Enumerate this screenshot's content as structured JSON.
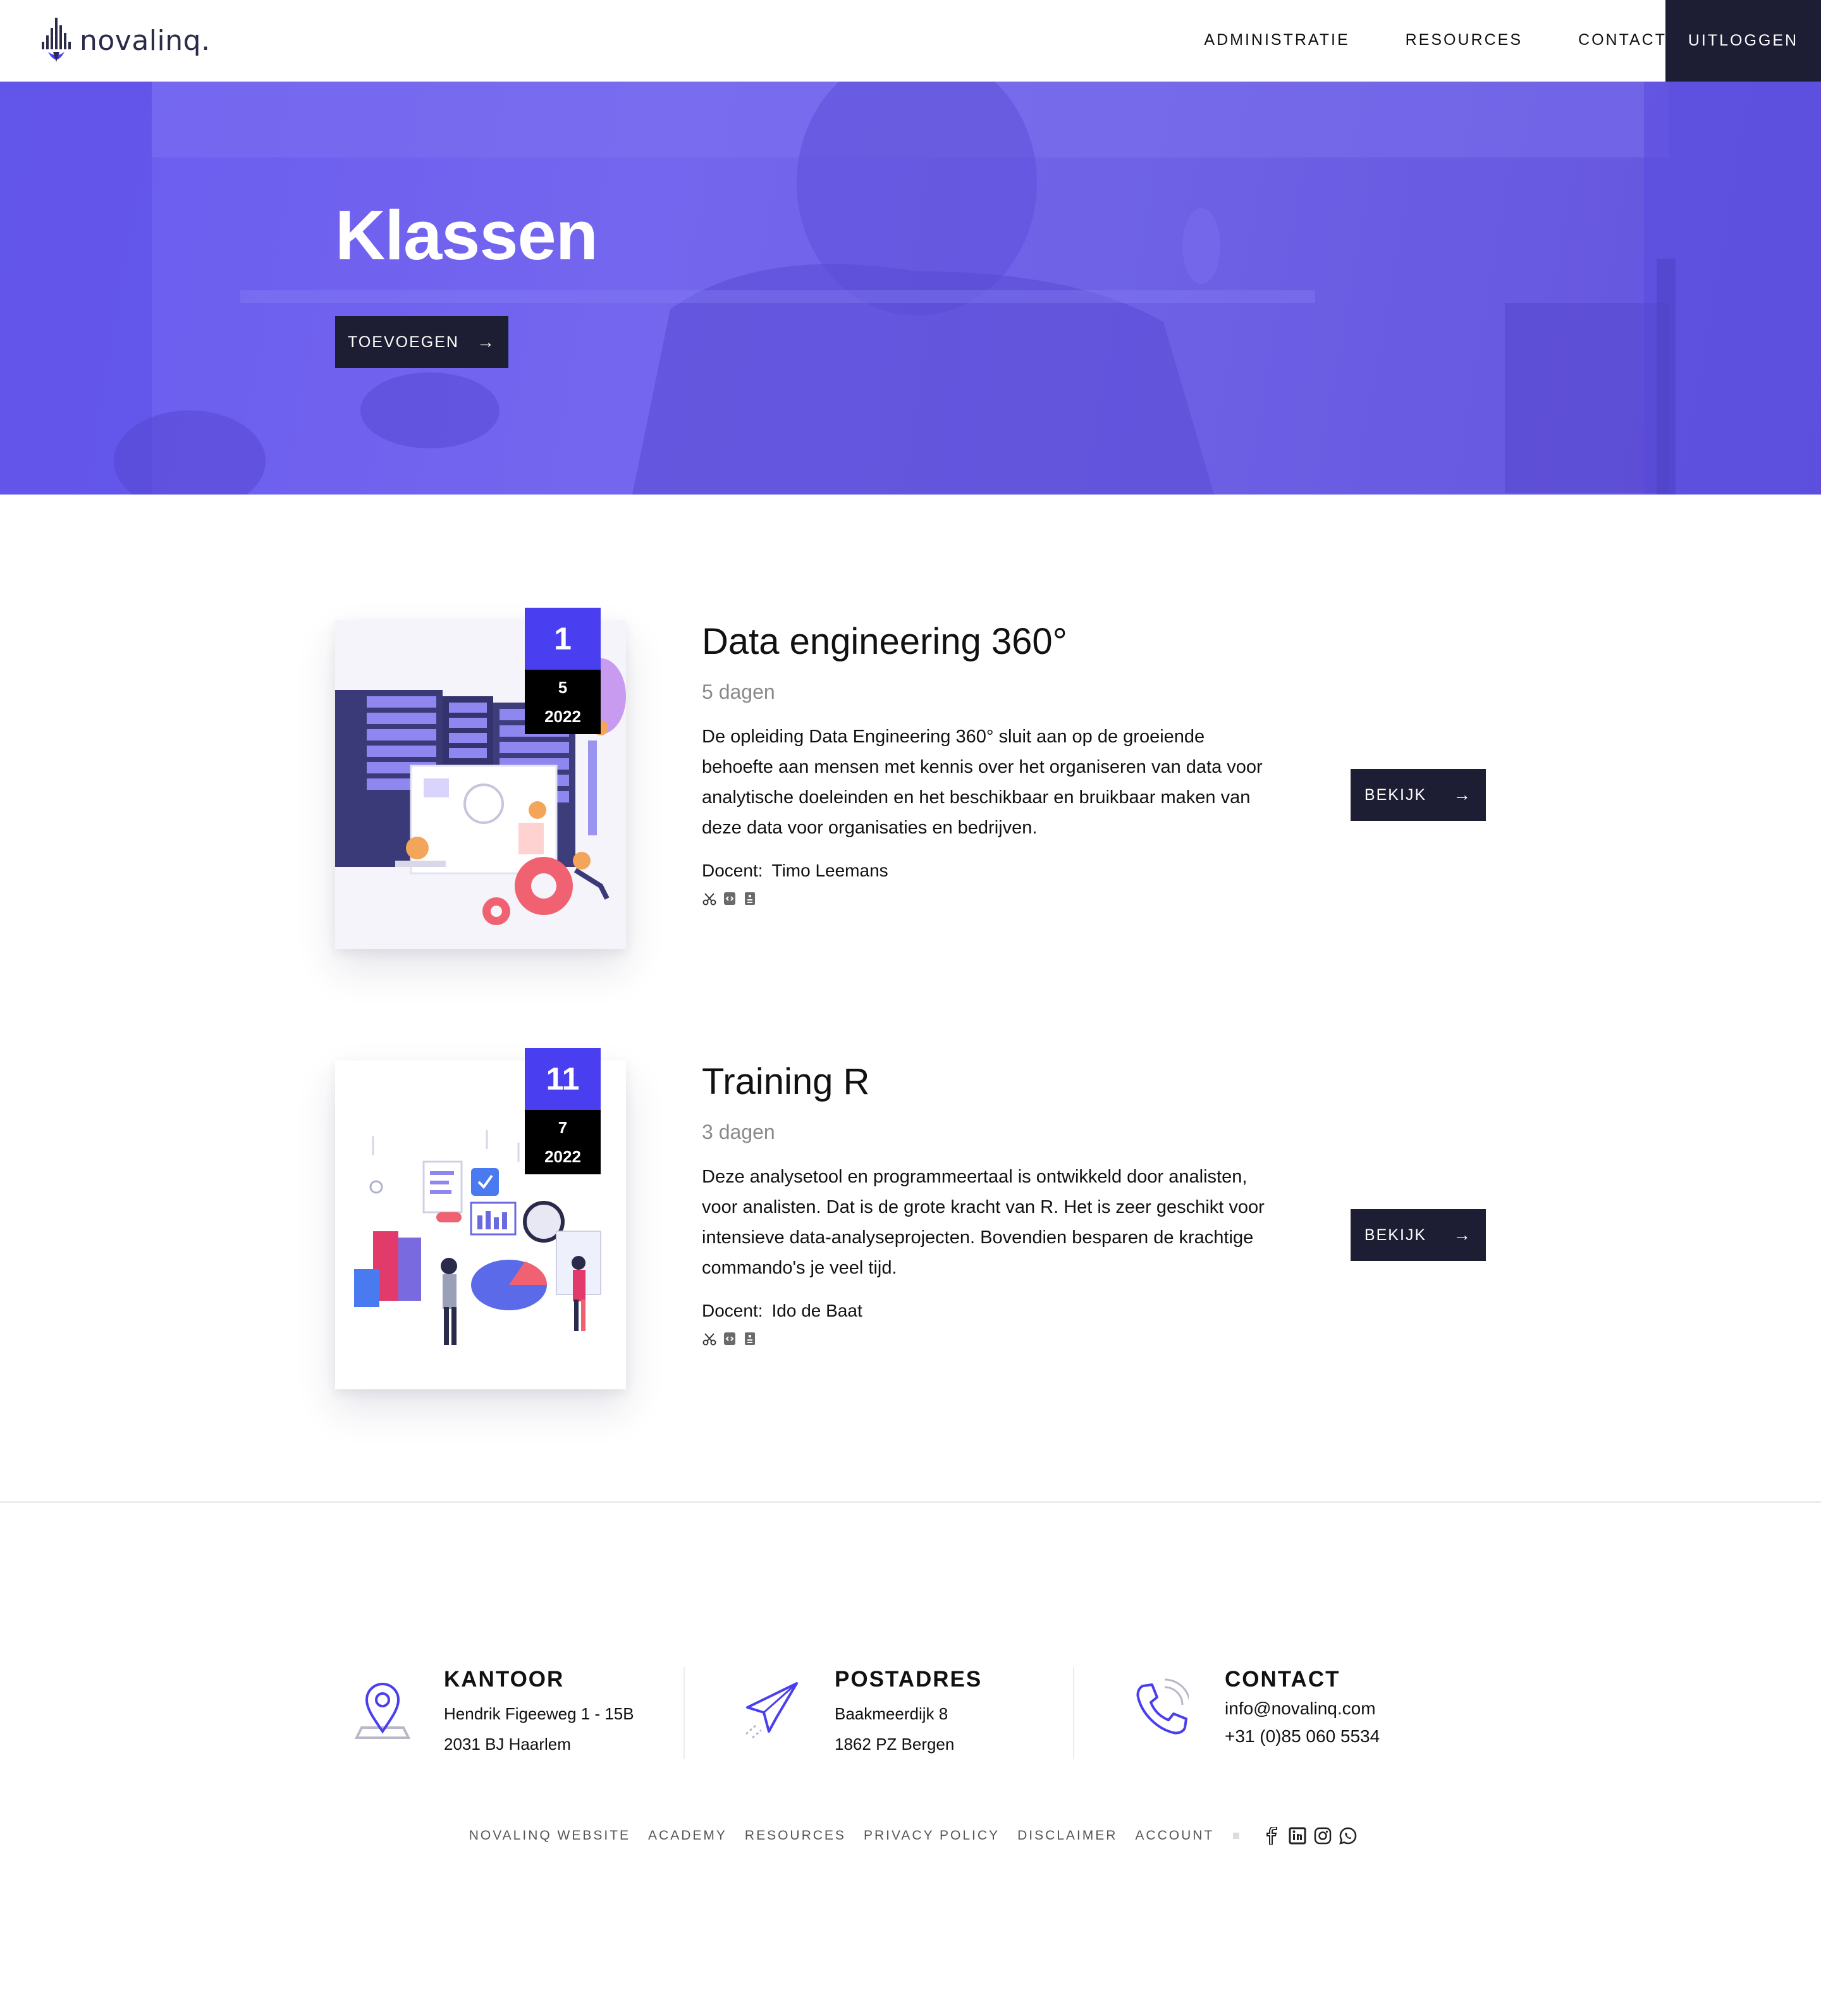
{
  "header": {
    "logo_text": "novalinq.",
    "nav": [
      "ADMINISTRATIE",
      "RESOURCES",
      "CONTACT"
    ],
    "logout": "UITLOGGEN"
  },
  "hero": {
    "title": "Klassen",
    "add_button": "TOEVOEGEN"
  },
  "courses": [
    {
      "day": "1",
      "month": "5",
      "year": "2022",
      "title": "Data engineering 360°",
      "duration": "5 dagen",
      "description": "De opleiding Data Engineering 360° sluit aan op de groeiende behoefte aan mensen met kennis over het organiseren van data voor analytische doeleinden en het beschikbaar en bruikbaar maken van deze data voor organisaties en bedrijven.",
      "teacher_label": "Docent:",
      "teacher": "Timo Leemans",
      "view_button": "BEKIJK"
    },
    {
      "day": "11",
      "month": "7",
      "year": "2022",
      "title": "Training R",
      "duration": "3 dagen",
      "description": "Deze analysetool en programmeertaal is ontwikkeld door analisten, voor analisten. Dat is de grote kracht van R. Het is zeer geschikt voor intensieve data-analyseprojecten. Bovendien besparen de krachtige commando's je veel tijd.",
      "teacher_label": "Docent:",
      "teacher": "Ido de Baat",
      "view_button": "BEKIJK"
    }
  ],
  "footer": {
    "office": {
      "title": "KANTOOR",
      "line1": "Hendrik Figeeweg 1 - 15B",
      "line2": "2031 BJ Haarlem"
    },
    "postal": {
      "title": "POSTADRES",
      "line1": "Baakmeerdijk 8",
      "line2": "1862 PZ Bergen"
    },
    "contact": {
      "title": "CONTACT",
      "email": "info@novalinq.com",
      "phone": "+31 (0)85 060 5534"
    },
    "links": [
      "NOVALINQ WEBSITE",
      "ACADEMY",
      "RESOURCES",
      "PRIVACY POLICY",
      "DISCLAIMER",
      "ACCOUNT"
    ],
    "socials": [
      "facebook-icon",
      "linkedin-icon",
      "instagram-icon",
      "whatsapp-icon"
    ]
  },
  "colors": {
    "accent": "#4a3ff0",
    "dark": "#1d1d33",
    "hero": "#6a5cf0"
  }
}
